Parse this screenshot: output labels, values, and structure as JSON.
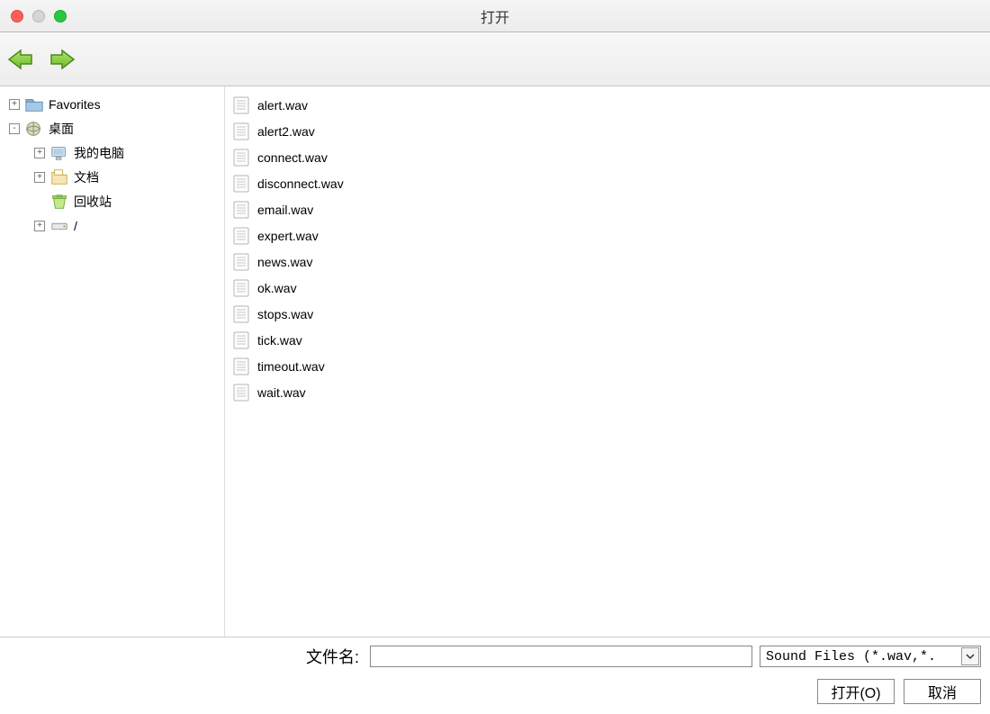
{
  "window": {
    "title": "打开"
  },
  "tree": [
    {
      "depth": 1,
      "expander": "+",
      "icon": "folder",
      "label": "Favorites"
    },
    {
      "depth": 1,
      "expander": "-",
      "icon": "desktop-globe",
      "label": "桌面"
    },
    {
      "depth": 2,
      "expander": "+",
      "icon": "computer",
      "label": "我的电脑"
    },
    {
      "depth": 2,
      "expander": "+",
      "icon": "documents",
      "label": "文档"
    },
    {
      "depth": 2,
      "expander": "",
      "icon": "recycle",
      "label": "回收站"
    },
    {
      "depth": 2,
      "expander": "+",
      "icon": "drive",
      "label": "/"
    }
  ],
  "files": [
    "alert.wav",
    "alert2.wav",
    "connect.wav",
    "disconnect.wav",
    "email.wav",
    "expert.wav",
    "news.wav",
    "ok.wav",
    "stops.wav",
    "tick.wav",
    "timeout.wav",
    "wait.wav"
  ],
  "bottom": {
    "filename_label": "文件名:",
    "filename_value": "",
    "filter_value": "Sound Files (*.wav,*.",
    "open_label": "打开(O)",
    "cancel_label": "取消"
  }
}
